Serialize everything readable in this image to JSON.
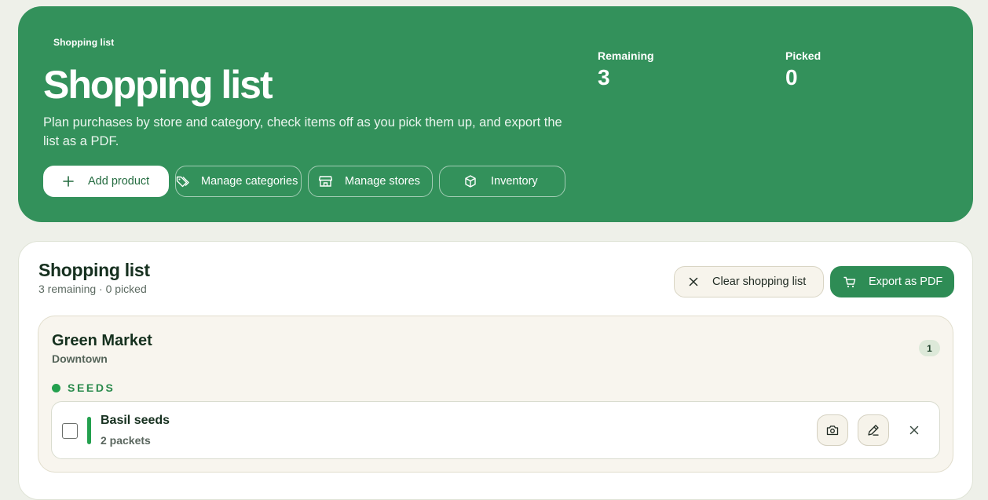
{
  "hero": {
    "eyebrow": "Shopping list",
    "title": "Shopping list",
    "description": "Plan purchases by store and category, check items off as you pick them up, and export the list as a PDF.",
    "actions": {
      "add": "Add product",
      "categories": "Manage categories",
      "stores": "Manage stores",
      "inventory": "Inventory"
    },
    "stats": {
      "remaining_label": "Remaining",
      "remaining_value": "3",
      "picked_label": "Picked",
      "picked_value": "0"
    }
  },
  "panel": {
    "title": "Shopping list",
    "subtitle": "3 remaining · 0 picked",
    "clear_label": "Clear shopping list",
    "export_label": "Export as PDF"
  },
  "stores": [
    {
      "name": "Green Market",
      "location": "Downtown",
      "count": "1",
      "categories": [
        {
          "label": "SEEDS",
          "color": "#23a04e",
          "items": [
            {
              "name": "Basil seeds",
              "quantity": "2 packets"
            }
          ]
        }
      ]
    }
  ],
  "icons": {
    "add": "plus-icon",
    "categories": "tag-icon",
    "stores": "storefront-icon",
    "inventory": "box-icon",
    "clear": "close-icon",
    "export": "cart-icon",
    "photo": "camera-icon",
    "edit": "pencil-icon",
    "remove": "close-icon"
  },
  "colors": {
    "brand": "#33915b",
    "accent": "#2e8c55",
    "category": "#23a04e"
  }
}
